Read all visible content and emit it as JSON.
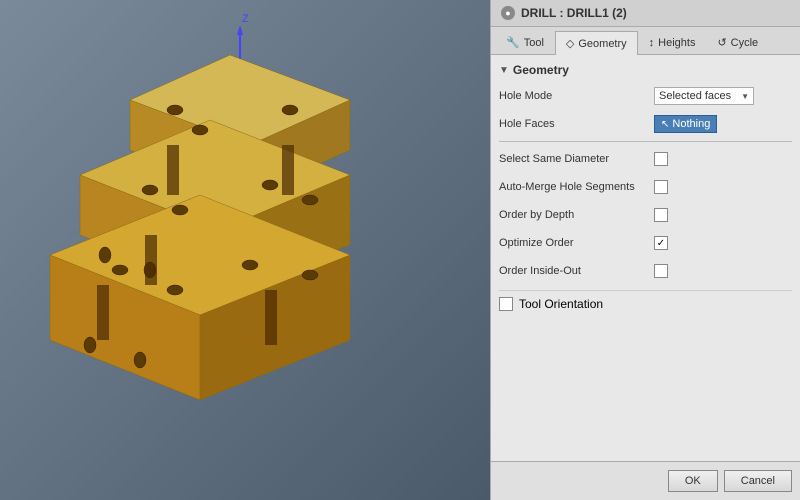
{
  "title": {
    "icon": "●",
    "text": "DRILL : DRILL1 (2)"
  },
  "tabs": [
    {
      "label": "Tool",
      "icon": "🔧",
      "active": false
    },
    {
      "label": "Geometry",
      "icon": "◇",
      "active": true
    },
    {
      "label": "Heights",
      "icon": "↕",
      "active": false
    },
    {
      "label": "Cycle",
      "icon": "↺",
      "active": false
    }
  ],
  "section": {
    "label": "Geometry"
  },
  "form": {
    "hole_mode_label": "Hole Mode",
    "hole_mode_value": "Selected faces",
    "hole_faces_label": "Hole Faces",
    "hole_faces_value": "Nothing",
    "select_same_diameter_label": "Select Same Diameter",
    "auto_merge_label": "Auto-Merge Hole Segments",
    "order_by_depth_label": "Order by Depth",
    "optimize_order_label": "Optimize Order",
    "order_inside_out_label": "Order Inside-Out",
    "tool_orientation_label": "Tool Orientation"
  },
  "buttons": {
    "ok": "OK",
    "cancel": "Cancel"
  },
  "checkboxes": {
    "select_same_diameter": false,
    "auto_merge": false,
    "order_by_depth": false,
    "optimize_order": true,
    "order_inside_out": false,
    "tool_orientation": false
  }
}
